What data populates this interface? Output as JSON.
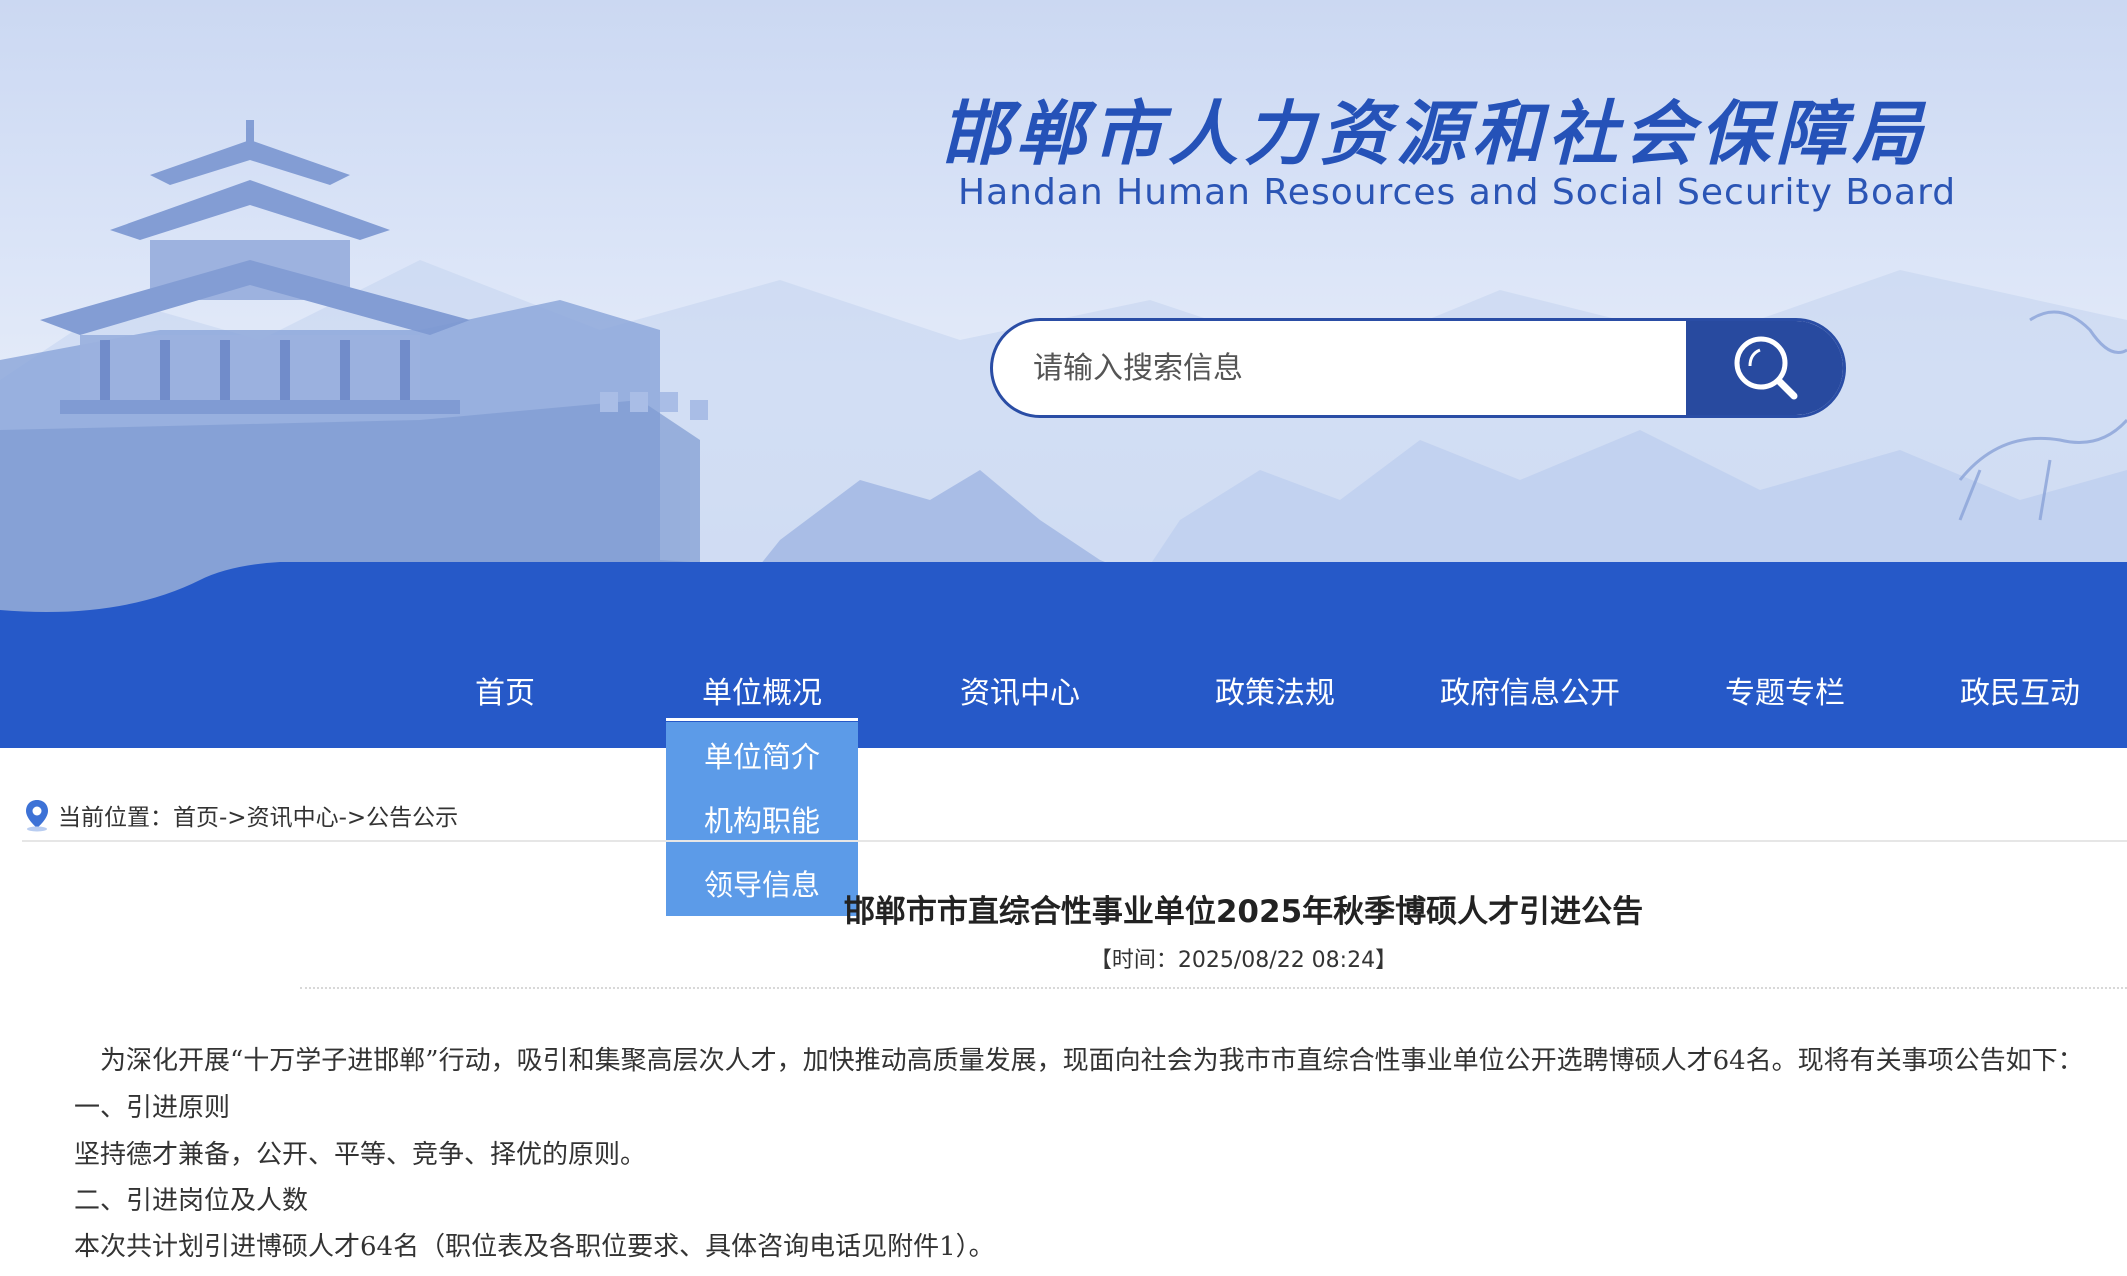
{
  "header": {
    "title": "邯郸市人力资源和社会保障局",
    "subtitle": "Handan Human Resources and Social Security Board"
  },
  "search": {
    "placeholder": "请输入搜索信息",
    "value": ""
  },
  "nav": {
    "items": [
      {
        "label": "首页"
      },
      {
        "label": "单位概况"
      },
      {
        "label": "资讯中心"
      },
      {
        "label": "政策法规"
      },
      {
        "label": "政府信息公开"
      },
      {
        "label": "专题专栏"
      },
      {
        "label": "政民互动"
      }
    ],
    "active": "单位概况",
    "dropdown": [
      "单位简介",
      "机构职能",
      "领导信息"
    ]
  },
  "breadcrumb": {
    "prefix": "当前位置：",
    "path": "首页->资讯中心->公告公示"
  },
  "article": {
    "title": "邯郸市市直综合性事业单位2025年秋季博硕人才引进公告",
    "time": "【时间：2025/08/22 08:24】",
    "paragraphs": [
      "为深化开展“十万学子进邯郸”行动，吸引和集聚高层次人才，加快推动高质量发展，现面向社会为我市市直综合性事业单位公开选聘博硕人才64名。现将有关事项公告如下：",
      "一、引进原则",
      "坚持德才兼备，公开、平等、竞争、择优的原则。",
      "二、引进岗位及人数",
      "本次共计划引进博硕人才64名（职位表及各职位要求、具体咨询电话见附件1）。"
    ]
  },
  "colors": {
    "nav_blue": "#2659c8",
    "dropdown_blue": "#5c9be8",
    "title_blue": "#2552b8",
    "search_button": "#284a9f"
  }
}
